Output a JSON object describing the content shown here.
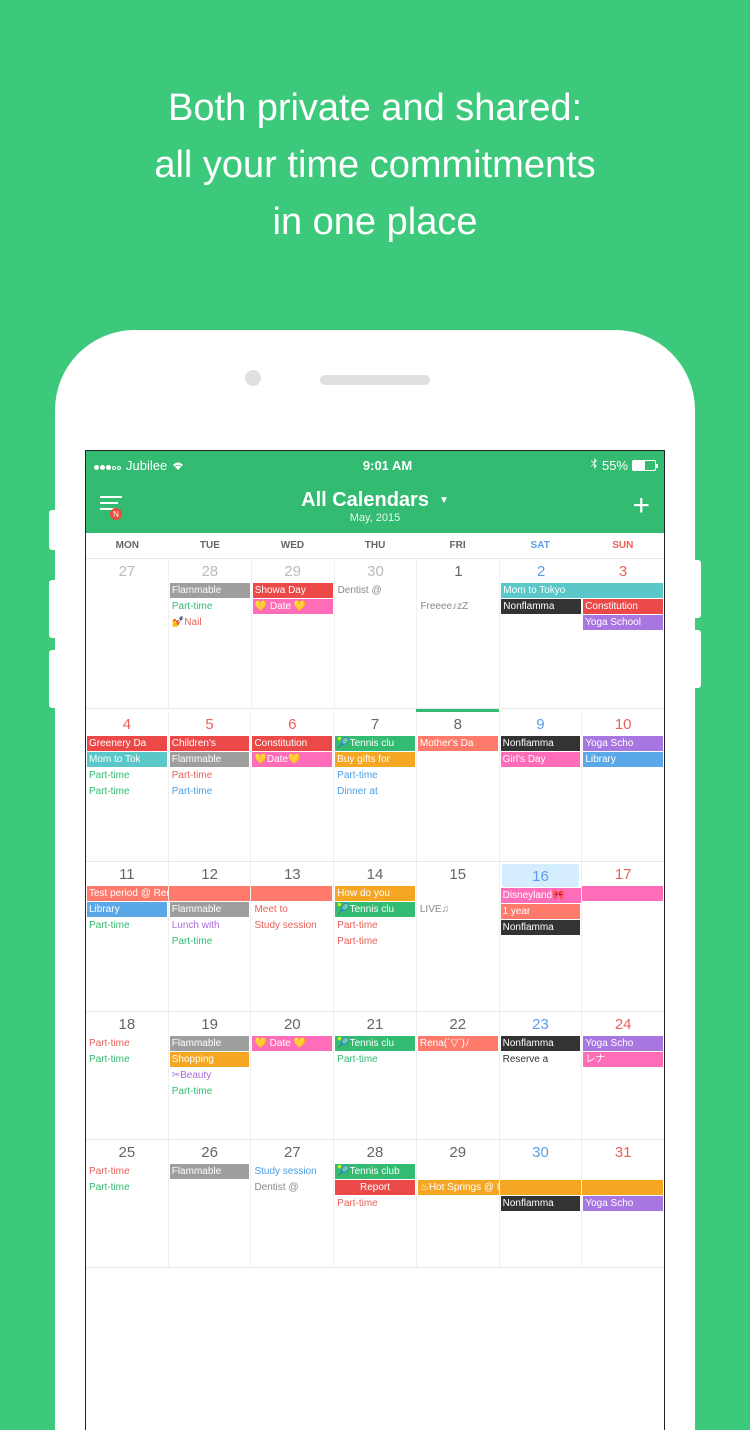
{
  "promo": {
    "line1": "Both private and shared:",
    "line2": "all your time commitments",
    "line3": "in one place"
  },
  "status": {
    "carrier": "Jubilee",
    "time": "9:01 AM",
    "battery_pct": "55%"
  },
  "header": {
    "title": "All Calendars",
    "subtitle": "May, 2015",
    "menu_badge": "N"
  },
  "weekdays": [
    "MON",
    "TUE",
    "WED",
    "THU",
    "FRI",
    "SAT",
    "SUN"
  ],
  "dates": {
    "w1": [
      "27",
      "28",
      "29",
      "30",
      "1",
      "2",
      "3"
    ],
    "w2": [
      "4",
      "5",
      "6",
      "7",
      "8",
      "9",
      "10"
    ],
    "w3": [
      "11",
      "12",
      "13",
      "14",
      "15",
      "16",
      "17"
    ],
    "w4": [
      "18",
      "19",
      "20",
      "21",
      "22",
      "23",
      "24"
    ],
    "w5": [
      "25",
      "26",
      "27",
      "28",
      "29",
      "30",
      "31"
    ]
  },
  "events": {
    "flammable": "Flammable",
    "showa": "Showa Day",
    "dentist": "Dentist @",
    "freeee": "Freeee♪zZ",
    "parttime": "Part-time",
    "date_heart": "💛 Date 💛",
    "date_heart2": "💛Date💛",
    "nail": "💅Nail",
    "mom_tokyo": "Mom to Tokyo",
    "nonflamma": "Nonflamma",
    "constitution": "Constitution",
    "yoga_school": "Yoga School",
    "yoga_scho": "Yoga Scho",
    "greenery": "Greenery Da",
    "childrens": "Children's",
    "tennis_clu": "🎾Tennis clu",
    "tennis_club": "🎾Tennis club",
    "mothers": "Mother's Da",
    "mom_tok": "Mom to Tok",
    "buy_gifts": "Buy gifts for",
    "girls_day": "Girl's Day",
    "library": "Library",
    "dinner": "Dinner at",
    "test_period": "Test period @ Rena",
    "how_do": "How do you",
    "live": "LIVE♫",
    "disneyland": "Disneyland🎀",
    "meet_to": "Meet to",
    "one_year": "1 year",
    "lunch_with": "Lunch with",
    "study_session": "Study session",
    "rena_face": "Rena(´▽`)ﾉ",
    "reserve": "Reserve a",
    "rena_jp": "レナ",
    "shopping": "Shopping",
    "beauty": "✂Beauty",
    "report": "Report",
    "hot_springs": "♨Hot Springs @ Ito"
  }
}
